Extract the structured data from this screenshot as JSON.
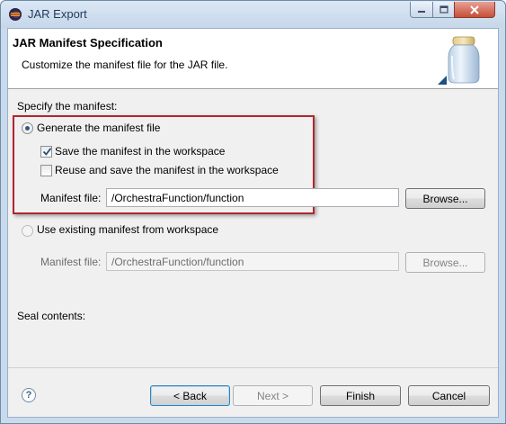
{
  "window": {
    "title": "JAR Export"
  },
  "banner": {
    "title": "JAR Manifest Specification",
    "description": "Customize the manifest file for the JAR file."
  },
  "manifest": {
    "section_label": "Specify the manifest:",
    "generate_label": "Generate the manifest file",
    "generate_selected": true,
    "save_in_workspace_label": "Save the manifest in the workspace",
    "save_in_workspace_checked": true,
    "reuse_label": "Reuse and save the manifest in the workspace",
    "reuse_checked": false,
    "manifest_file_label": "Manifest file:",
    "manifest_file_value": "/OrchestraFunction/function",
    "browse_label": "Browse...",
    "use_existing_label": "Use existing manifest from workspace",
    "use_existing_selected": false,
    "existing_file_label": "Manifest file:",
    "existing_file_value": "/OrchestraFunction/function",
    "existing_browse_label": "Browse..."
  },
  "seal": {
    "label": "Seal contents:"
  },
  "footer": {
    "back_label": "< Back",
    "next_label": "Next >",
    "finish_label": "Finish",
    "cancel_label": "Cancel",
    "help_symbol": "?"
  },
  "icons": {
    "app": "eclipse-icon",
    "banner": "jar-icon",
    "help": "help-icon"
  }
}
